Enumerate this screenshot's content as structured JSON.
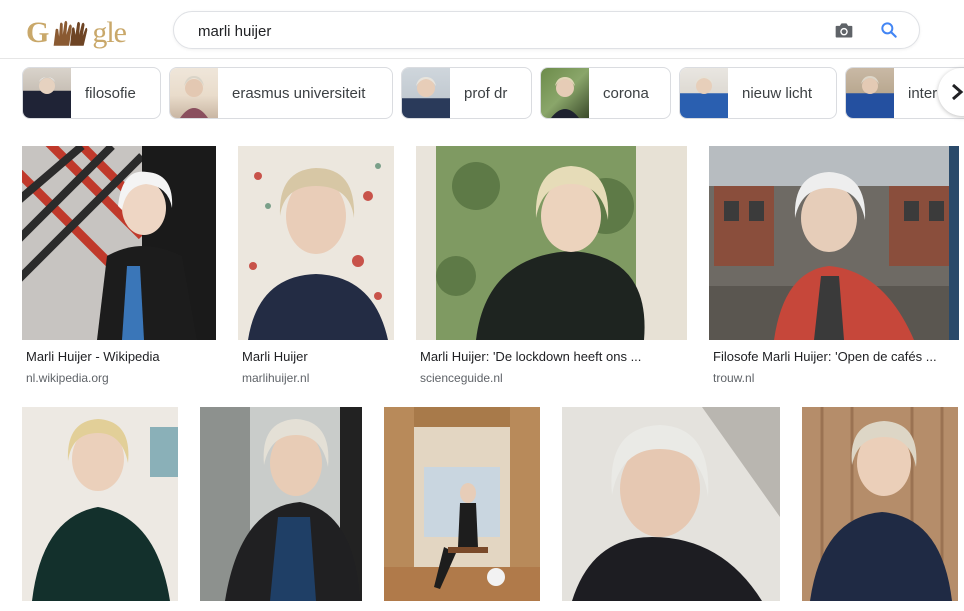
{
  "logo": {
    "letter_g": "G",
    "middle": "✋✋",
    "rest": "gle"
  },
  "search": {
    "query": "marli huijer",
    "placeholder": ""
  },
  "chips": [
    {
      "label": "filosofie"
    },
    {
      "label": "erasmus universiteit"
    },
    {
      "label": "prof dr"
    },
    {
      "label": "corona"
    },
    {
      "label": "nieuw licht"
    },
    {
      "label": "inter"
    }
  ],
  "results_row1": [
    {
      "title": "Marli Huijer - Wikipedia",
      "source": "nl.wikipedia.org"
    },
    {
      "title": "Marli Huijer",
      "source": "marlihuijer.nl"
    },
    {
      "title": "Marli Huijer: 'De lockdown heeft ons ...",
      "source": "scienceguide.nl"
    },
    {
      "title": "Filosofe Marli Huijer: 'Open de cafés ...",
      "source": "trouw.nl"
    }
  ],
  "colors": {
    "link_text": "#202124",
    "source_text": "#5f6368",
    "search_blue": "#4285f4",
    "chip_border": "#dadce0"
  },
  "icons": [
    "camera-icon",
    "search-icon",
    "chevron-right-icon"
  ]
}
